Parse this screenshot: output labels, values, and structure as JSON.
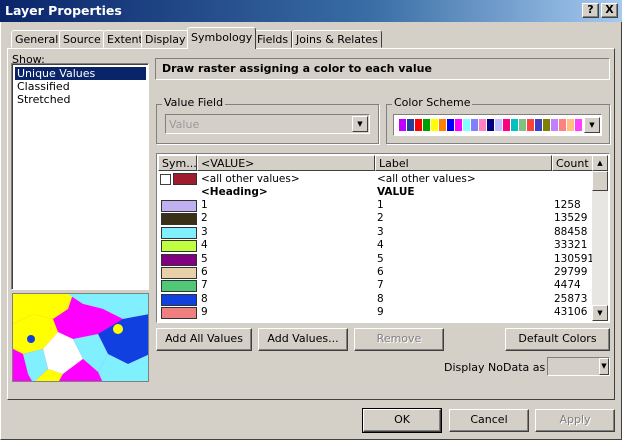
{
  "window": {
    "title": "Layer Properties",
    "help_button": "?",
    "close_button": "X"
  },
  "tabs": [
    {
      "label": "General"
    },
    {
      "label": "Source"
    },
    {
      "label": "Extent"
    },
    {
      "label": "Display"
    },
    {
      "label": "Symbology",
      "active": true
    },
    {
      "label": "Fields"
    },
    {
      "label": "Joins & Relates"
    }
  ],
  "show": {
    "label": "Show:",
    "items": [
      {
        "label": "Unique Values",
        "selected": true
      },
      {
        "label": "Classified"
      },
      {
        "label": "Stretched"
      }
    ]
  },
  "description": "Draw raster assigning a color to each value",
  "value_field": {
    "group_label": "Value Field",
    "value": "Value",
    "enabled": false
  },
  "color_scheme": {
    "group_label": "Color Scheme",
    "swatches": [
      "#c000ff",
      "#2040a0",
      "#ff0000",
      "#00a000",
      "#ffff00",
      "#ff8000",
      "#0000ff",
      "#ff00ff",
      "#80ffff",
      "#8080ff",
      "#ff80c0",
      "#000080",
      "#c0c0ff",
      "#ff0080",
      "#00c0c0",
      "#80c080",
      "#ff4040",
      "#4040c0",
      "#808000",
      "#c080ff",
      "#ff8080",
      "#ffc080",
      "#ff40ff"
    ]
  },
  "table": {
    "headers": {
      "sym": "Sym...",
      "value": "<VALUE>",
      "label": "Label",
      "count": "Count"
    },
    "other_row": {
      "value": "<all other values>",
      "label": "<all other values>",
      "color": "#a01c2c"
    },
    "heading_row": {
      "value": "<Heading>",
      "label": "VALUE"
    },
    "rows": [
      {
        "value": "1",
        "label": "1",
        "count": "1258",
        "color": "#c0b0f0"
      },
      {
        "value": "2",
        "label": "2",
        "count": "13529",
        "color": "#3a3018"
      },
      {
        "value": "3",
        "label": "3",
        "count": "88458",
        "color": "#80f0ff"
      },
      {
        "value": "4",
        "label": "4",
        "count": "33321",
        "color": "#c0ff40"
      },
      {
        "value": "5",
        "label": "5",
        "count": "130591",
        "color": "#800080"
      },
      {
        "value": "6",
        "label": "6",
        "count": "29799",
        "color": "#e8d0a8"
      },
      {
        "value": "7",
        "label": "7",
        "count": "4474",
        "color": "#50c878"
      },
      {
        "value": "8",
        "label": "8",
        "count": "25873",
        "color": "#1040e0"
      },
      {
        "value": "9",
        "label": "9",
        "count": "43106",
        "color": "#f08080"
      }
    ]
  },
  "actions": {
    "add_all": "Add All Values",
    "add_values": "Add Values...",
    "remove": "Remove",
    "default_colors": "Default Colors"
  },
  "nodata": {
    "label": "Display NoData as"
  },
  "footer": {
    "ok": "OK",
    "cancel": "Cancel",
    "apply": "Apply"
  }
}
